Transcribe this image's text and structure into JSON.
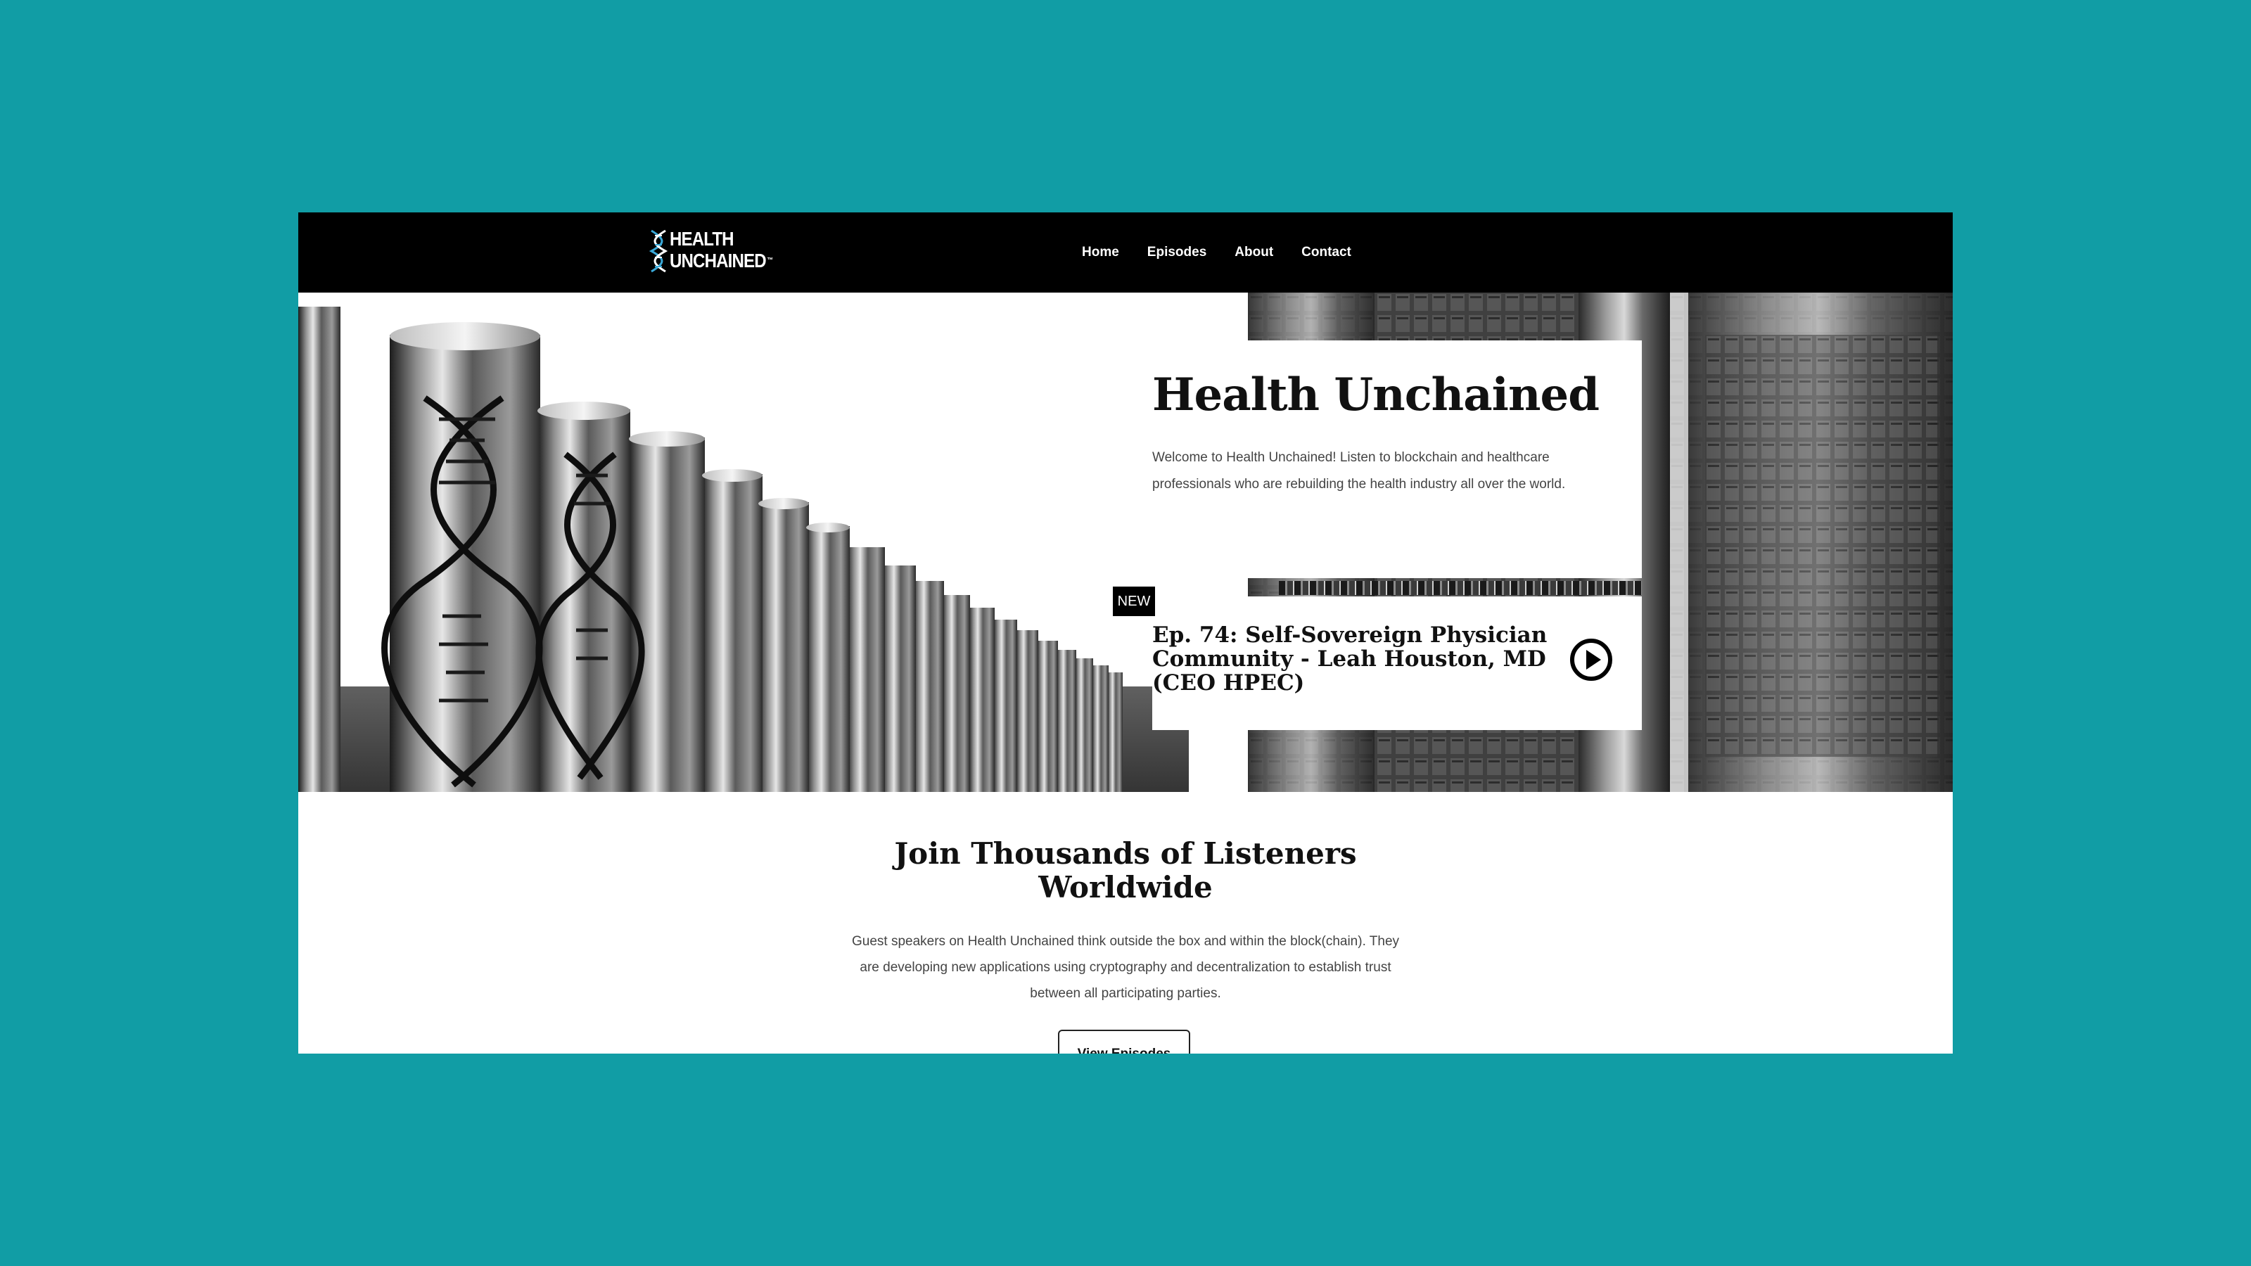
{
  "brand": {
    "logo_line1": "HEALTH",
    "logo_line2": "UNCHAINED",
    "logo_mark": "™",
    "accent_color": "#3aa9d8"
  },
  "page": {
    "background": "#119da5"
  },
  "nav": {
    "items": [
      {
        "label": "Home"
      },
      {
        "label": "Episodes"
      },
      {
        "label": "About"
      },
      {
        "label": "Contact"
      }
    ]
  },
  "hero": {
    "title": "Health Unchained",
    "description": "Welcome to Health Unchained! Listen to blockchain and healthcare professionals who are rebuilding the health industry all over the world.",
    "badge": "NEW",
    "episode_title": "Ep. 74: Self-Sovereign Physician Community - Leah Houston, MD (CEO HPEC)",
    "play_icon": "play-circle-icon",
    "images": [
      "dna-helix-tubes-image",
      "server-racks-image"
    ]
  },
  "section": {
    "title": "Join Thousands of Listeners Worldwide",
    "description": "Guest speakers on Health Unchained think outside the box and within the block(chain). They are developing new applications using cryptography and decentralization to establish trust between all participating parties.",
    "button_label": "View Episodes"
  }
}
